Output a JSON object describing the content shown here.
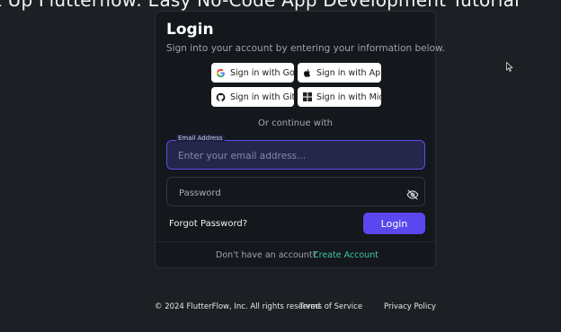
{
  "video": {
    "title": "t Up Flutterflow: Easy No-Code App Development Tutorial"
  },
  "login": {
    "title": "Login",
    "subtitle": "Sign into your account by entering your information below.",
    "social": {
      "google": "Sign in with Google",
      "apple": "Sign in with Apple",
      "github": "Sign in with GitHub",
      "microsoft": "Sign in with Microsoft"
    },
    "or_text": "Or continue with",
    "email": {
      "label": "Email Address",
      "placeholder": "Enter your email address...",
      "value": ""
    },
    "password": {
      "placeholder": "Password",
      "value": ""
    },
    "forgot": "Forgot Password?",
    "login_button": "Login",
    "no_account": "Don't have an account?",
    "create_account": "Create Account"
  },
  "footer": {
    "copyright": "© 2024 FlutterFlow, Inc. All rights reserved",
    "terms": "Terms of Service",
    "privacy": "Privacy Policy"
  },
  "colors": {
    "background": "#1c1f23",
    "card": "#14171b",
    "accent": "#5a47ee",
    "link": "#3ec9a7"
  },
  "icons": [
    "google-icon",
    "apple-icon",
    "github-icon",
    "microsoft-icon",
    "eye-off-icon",
    "cursor-icon"
  ]
}
